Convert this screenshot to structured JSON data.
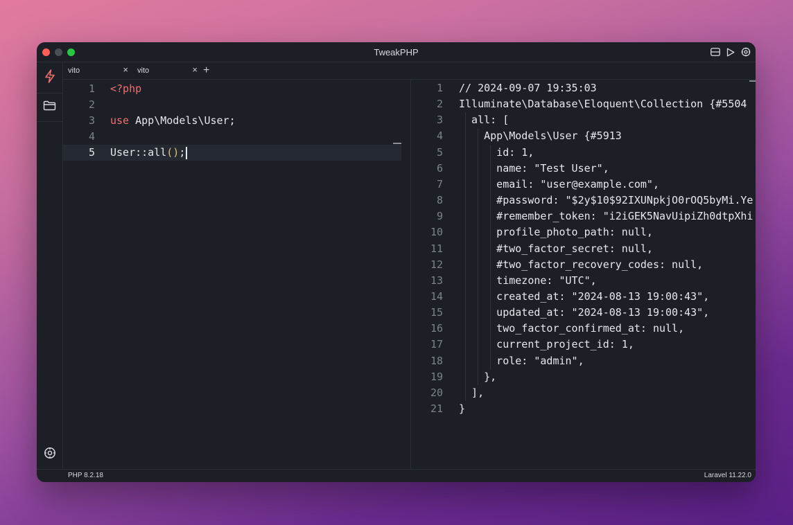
{
  "window": {
    "title": "TweakPHP"
  },
  "tabs": [
    {
      "label": "vito",
      "close": "×"
    },
    {
      "label": "vito",
      "close": "×"
    }
  ],
  "tab_add": "+",
  "editor": {
    "lines": [
      {
        "n": "1",
        "parts": [
          {
            "t": "<?php",
            "c": "kw-tag"
          }
        ]
      },
      {
        "n": "2",
        "parts": []
      },
      {
        "n": "3",
        "parts": [
          {
            "t": "use",
            "c": "kw-use"
          },
          {
            "t": " App\\Models\\User;",
            "c": ""
          }
        ]
      },
      {
        "n": "4",
        "parts": []
      },
      {
        "n": "5",
        "parts": [
          {
            "t": "User::all",
            "c": ""
          },
          {
            "t": "()",
            "c": "paren"
          },
          {
            "t": ";",
            "c": ""
          }
        ]
      }
    ]
  },
  "output": {
    "lines": [
      {
        "n": "1",
        "text": "// 2024-09-07 19:35:03"
      },
      {
        "n": "2",
        "text": "Illuminate\\Database\\Eloquent\\Collection {#5504"
      },
      {
        "n": "3",
        "text": "  all: ["
      },
      {
        "n": "4",
        "text": "    App\\Models\\User {#5913"
      },
      {
        "n": "5",
        "text": "      id: 1,"
      },
      {
        "n": "6",
        "text": "      name: \"Test User\","
      },
      {
        "n": "7",
        "text": "      email: \"user@example.com\","
      },
      {
        "n": "8",
        "text": "      #password: \"$2y$10$92IXUNpkjO0rOQ5byMi.Ye"
      },
      {
        "n": "9",
        "text": "      #remember_token: \"i2iGEK5NavUipiZh0dtpXhi"
      },
      {
        "n": "10",
        "text": "      profile_photo_path: null,"
      },
      {
        "n": "11",
        "text": "      #two_factor_secret: null,"
      },
      {
        "n": "12",
        "text": "      #two_factor_recovery_codes: null,"
      },
      {
        "n": "13",
        "text": "      timezone: \"UTC\","
      },
      {
        "n": "14",
        "text": "      created_at: \"2024-08-13 19:00:43\","
      },
      {
        "n": "15",
        "text": "      updated_at: \"2024-08-13 19:00:43\","
      },
      {
        "n": "16",
        "text": "      two_factor_confirmed_at: null,"
      },
      {
        "n": "17",
        "text": "      current_project_id: 1,"
      },
      {
        "n": "18",
        "text": "      role: \"admin\","
      },
      {
        "n": "19",
        "text": "    },"
      },
      {
        "n": "20",
        "text": "  ],"
      },
      {
        "n": "21",
        "text": "}"
      }
    ]
  },
  "status": {
    "php_version": "PHP 8.2.18",
    "framework_version": "Laravel 11.22.0"
  },
  "icons": {
    "run": "lightning-icon",
    "folder": "folder-icon",
    "settings": "gear-icon",
    "layout": "split-layout-icon",
    "play": "play-icon",
    "titlebar_settings": "gear-icon"
  },
  "colors": {
    "accent": "#ef6f6f",
    "background": "#1c1f26"
  }
}
